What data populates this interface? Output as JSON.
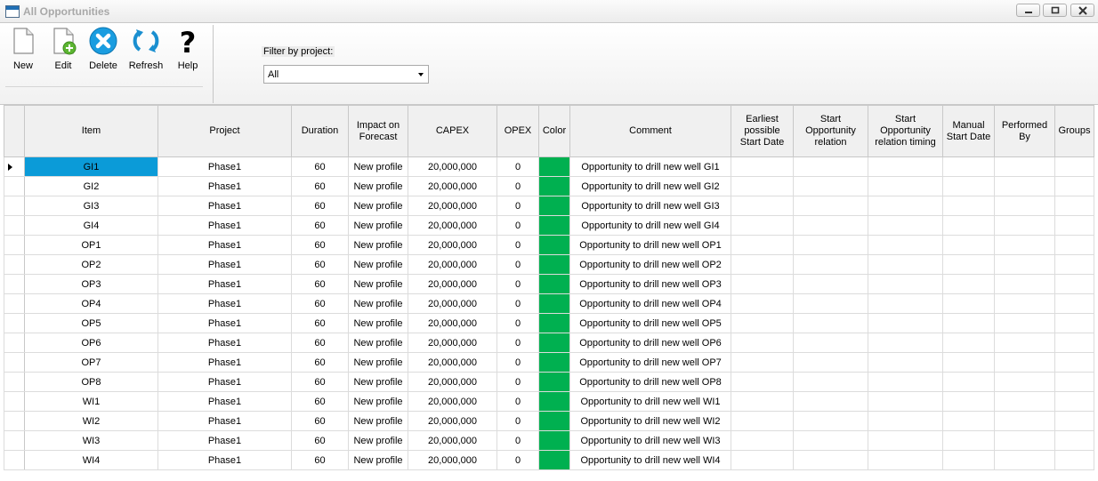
{
  "window": {
    "title": "All Opportunities",
    "icons": [
      "app-window-icon",
      "minimize-icon",
      "maximize-icon",
      "close-icon"
    ]
  },
  "toolbar": {
    "buttons": [
      {
        "label": "New",
        "icon": "new-document-icon"
      },
      {
        "label": "Edit",
        "icon": "edit-document-icon"
      },
      {
        "label": "Delete",
        "icon": "delete-icon"
      },
      {
        "label": "Refresh",
        "icon": "refresh-icon"
      },
      {
        "label": "Help",
        "icon": "help-icon"
      }
    ],
    "filter_label": "Filter by project:",
    "filter_value": "All"
  },
  "colors": {
    "accent": "#0b9bd8",
    "opportunity_color": "#00b050"
  },
  "grid": {
    "columns": [
      "Item",
      "Project",
      "Duration",
      "Impact on Forecast",
      "CAPEX",
      "OPEX",
      "Color",
      "Comment",
      "Earliest possible Start Date",
      "Start Opportunity relation",
      "Start Opportunity relation timing",
      "Manual Start Date",
      "Performed By",
      "Groups"
    ],
    "rows": [
      {
        "item": "GI1",
        "project": "Phase1",
        "duration": "60",
        "impact": "New profile",
        "capex": "20,000,000",
        "opex": "0",
        "comment": "Opportunity to drill new well GI1"
      },
      {
        "item": "GI2",
        "project": "Phase1",
        "duration": "60",
        "impact": "New profile",
        "capex": "20,000,000",
        "opex": "0",
        "comment": "Opportunity to drill new well GI2"
      },
      {
        "item": "GI3",
        "project": "Phase1",
        "duration": "60",
        "impact": "New profile",
        "capex": "20,000,000",
        "opex": "0",
        "comment": "Opportunity to drill new well GI3"
      },
      {
        "item": "GI4",
        "project": "Phase1",
        "duration": "60",
        "impact": "New profile",
        "capex": "20,000,000",
        "opex": "0",
        "comment": "Opportunity to drill new well GI4"
      },
      {
        "item": "OP1",
        "project": "Phase1",
        "duration": "60",
        "impact": "New profile",
        "capex": "20,000,000",
        "opex": "0",
        "comment": "Opportunity to drill new well OP1"
      },
      {
        "item": "OP2",
        "project": "Phase1",
        "duration": "60",
        "impact": "New profile",
        "capex": "20,000,000",
        "opex": "0",
        "comment": "Opportunity to drill new well OP2"
      },
      {
        "item": "OP3",
        "project": "Phase1",
        "duration": "60",
        "impact": "New profile",
        "capex": "20,000,000",
        "opex": "0",
        "comment": "Opportunity to drill new well OP3"
      },
      {
        "item": "OP4",
        "project": "Phase1",
        "duration": "60",
        "impact": "New profile",
        "capex": "20,000,000",
        "opex": "0",
        "comment": "Opportunity to drill new well OP4"
      },
      {
        "item": "OP5",
        "project": "Phase1",
        "duration": "60",
        "impact": "New profile",
        "capex": "20,000,000",
        "opex": "0",
        "comment": "Opportunity to drill new well OP5"
      },
      {
        "item": "OP6",
        "project": "Phase1",
        "duration": "60",
        "impact": "New profile",
        "capex": "20,000,000",
        "opex": "0",
        "comment": "Opportunity to drill new well OP6"
      },
      {
        "item": "OP7",
        "project": "Phase1",
        "duration": "60",
        "impact": "New profile",
        "capex": "20,000,000",
        "opex": "0",
        "comment": "Opportunity to drill new well OP7"
      },
      {
        "item": "OP8",
        "project": "Phase1",
        "duration": "60",
        "impact": "New profile",
        "capex": "20,000,000",
        "opex": "0",
        "comment": "Opportunity to drill new well OP8"
      },
      {
        "item": "WI1",
        "project": "Phase1",
        "duration": "60",
        "impact": "New profile",
        "capex": "20,000,000",
        "opex": "0",
        "comment": "Opportunity to drill new well WI1"
      },
      {
        "item": "WI2",
        "project": "Phase1",
        "duration": "60",
        "impact": "New profile",
        "capex": "20,000,000",
        "opex": "0",
        "comment": "Opportunity to drill new well WI2"
      },
      {
        "item": "WI3",
        "project": "Phase1",
        "duration": "60",
        "impact": "New profile",
        "capex": "20,000,000",
        "opex": "0",
        "comment": "Opportunity to drill new well WI3"
      },
      {
        "item": "WI4",
        "project": "Phase1",
        "duration": "60",
        "impact": "New profile",
        "capex": "20,000,000",
        "opex": "0",
        "comment": "Opportunity to drill new well WI4"
      }
    ]
  }
}
